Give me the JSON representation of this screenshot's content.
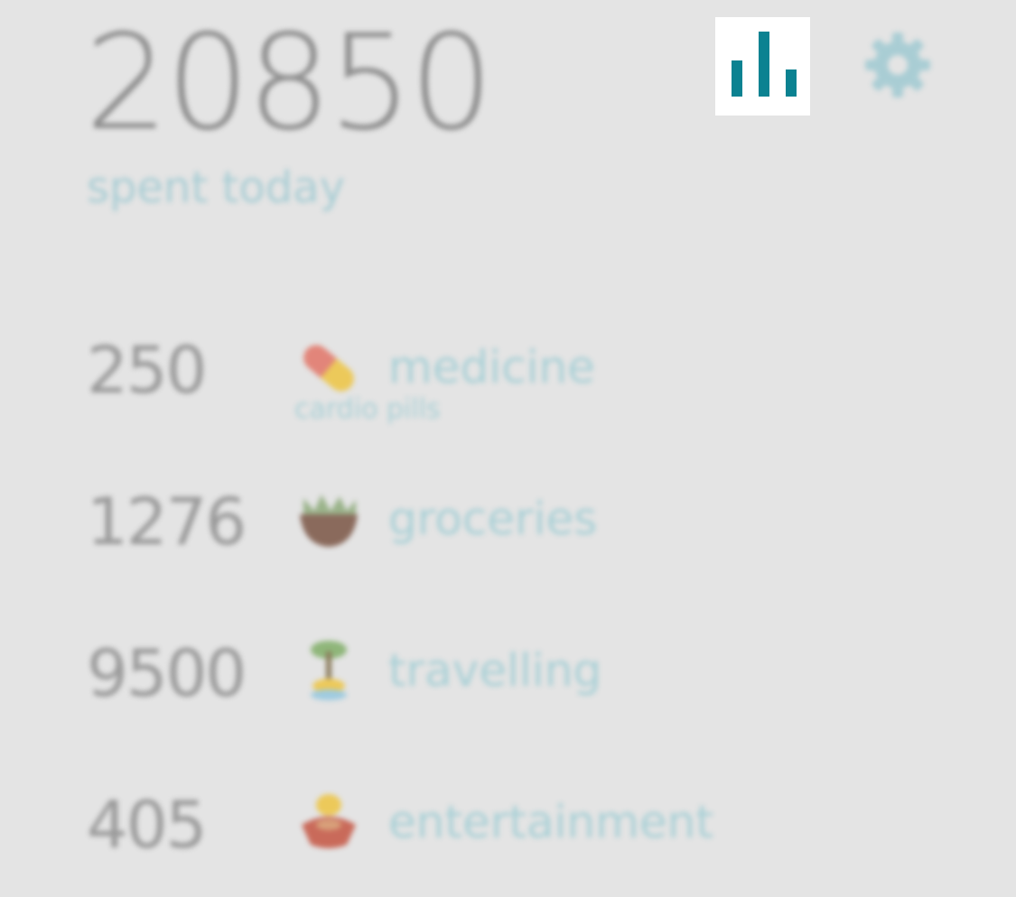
{
  "summary": {
    "total": "20850",
    "label": "spent today"
  },
  "toolbar": {
    "stats_icon": "bar-chart-icon",
    "settings_icon": "gear-icon",
    "accent_color": "#0b8291"
  },
  "expenses": [
    {
      "amount": "250",
      "category": "medicine",
      "note": "cardio pills",
      "icon": "pill-icon"
    },
    {
      "amount": "1276",
      "category": "groceries",
      "note": "",
      "icon": "grocery-bag-icon"
    },
    {
      "amount": "9500",
      "category": "travelling",
      "note": "",
      "icon": "palm-island-icon"
    },
    {
      "amount": "405",
      "category": "entertainment",
      "note": "",
      "icon": "popcorn-icon"
    }
  ]
}
